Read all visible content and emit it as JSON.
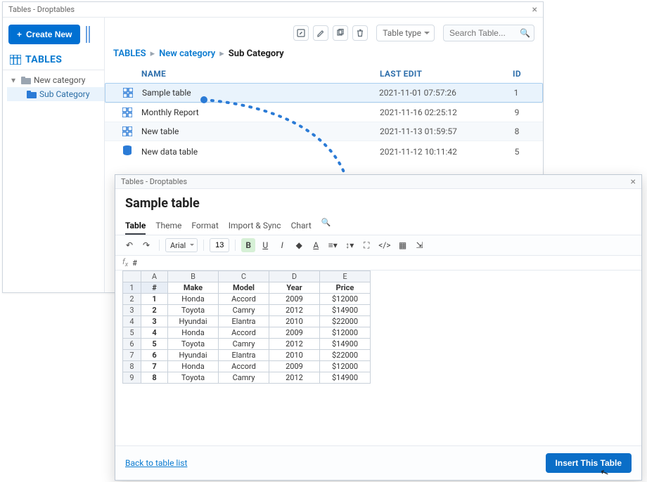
{
  "win1": {
    "title": "Tables - Droptables",
    "create_label": "Create New",
    "tables_heading": "TABLES",
    "tree": {
      "item1": "New category",
      "item2": "Sub Category"
    },
    "toolbar": {
      "type_label": "Table type",
      "search_placeholder": "Search Table..."
    },
    "breadcrumbs": {
      "a": "TABLES",
      "b": "New category",
      "c": "Sub Category"
    },
    "list": {
      "head": {
        "name": "NAME",
        "edit": "LAST EDIT",
        "id": "ID"
      },
      "rows": [
        {
          "name": "Sample table",
          "edit": "2021-11-01 07:57:26",
          "id": "1",
          "icon": "grid"
        },
        {
          "name": "Monthly Report",
          "edit": "2021-11-16 02:25:12",
          "id": "9",
          "icon": "grid"
        },
        {
          "name": "New table",
          "edit": "2021-11-13 01:59:57",
          "id": "8",
          "icon": "grid"
        },
        {
          "name": "New data table",
          "edit": "2021-11-12 10:11:42",
          "id": "5",
          "icon": "db"
        }
      ]
    }
  },
  "win2": {
    "title": "Tables - Droptables",
    "heading": "Sample table",
    "tabs": {
      "table": "Table",
      "theme": "Theme",
      "format": "Format",
      "import": "Import & Sync",
      "chart": "Chart"
    },
    "toolbar": {
      "font": "Arial",
      "size": "13"
    },
    "fx_value": "#",
    "columns": [
      "A",
      "B",
      "C",
      "D",
      "E"
    ],
    "header_row": [
      "#",
      "Make",
      "Model",
      "Year",
      "Price"
    ],
    "rows": [
      [
        "1",
        "Honda",
        "Accord",
        "2009",
        "$12000"
      ],
      [
        "2",
        "Toyota",
        "Camry",
        "2012",
        "$14900"
      ],
      [
        "3",
        "Hyundai",
        "Elantra",
        "2010",
        "$22000"
      ],
      [
        "4",
        "Honda",
        "Accord",
        "2009",
        "$12000"
      ],
      [
        "5",
        "Toyota",
        "Camry",
        "2012",
        "$14900"
      ],
      [
        "6",
        "Hyundai",
        "Elantra",
        "2010",
        "$22000"
      ],
      [
        "7",
        "Honda",
        "Accord",
        "2009",
        "$12000"
      ],
      [
        "8",
        "Toyota",
        "Camry",
        "2012",
        "$14900"
      ]
    ],
    "footer": {
      "back": "Back to table list",
      "insert": "Insert This Table"
    }
  }
}
